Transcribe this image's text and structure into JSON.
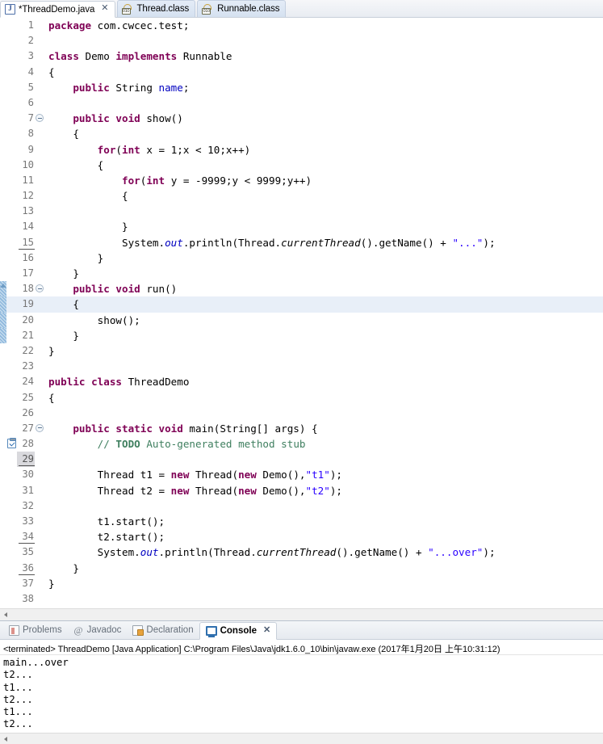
{
  "editor_tabs": [
    {
      "label": "*ThreadDemo.java",
      "icon": "java-file-icon",
      "active": true,
      "closeable": true
    },
    {
      "label": "Thread.class",
      "icon": "class-file-icon",
      "active": false,
      "closeable": false
    },
    {
      "label": "Runnable.class",
      "icon": "class-file-icon",
      "active": false,
      "closeable": false
    }
  ],
  "code": {
    "lines": [
      {
        "n": 1,
        "fold": false,
        "todo": false,
        "change": false,
        "cur": false,
        "numstyle": "plain",
        "tokens": [
          {
            "t": "package ",
            "c": "kw"
          },
          {
            "t": "com.cwcec.test;",
            "c": ""
          }
        ]
      },
      {
        "n": 2,
        "fold": false,
        "todo": false,
        "change": false,
        "cur": false,
        "numstyle": "plain",
        "tokens": []
      },
      {
        "n": 3,
        "fold": false,
        "todo": false,
        "change": false,
        "cur": false,
        "numstyle": "plain",
        "tokens": [
          {
            "t": "class ",
            "c": "kw"
          },
          {
            "t": "Demo ",
            "c": ""
          },
          {
            "t": "implements ",
            "c": "kw"
          },
          {
            "t": "Runnable",
            "c": ""
          }
        ]
      },
      {
        "n": 4,
        "fold": false,
        "todo": false,
        "change": false,
        "cur": false,
        "numstyle": "plain",
        "tokens": [
          {
            "t": "{",
            "c": ""
          }
        ]
      },
      {
        "n": 5,
        "fold": false,
        "todo": false,
        "change": false,
        "cur": false,
        "numstyle": "plain",
        "tokens": [
          {
            "t": "    ",
            "c": ""
          },
          {
            "t": "public ",
            "c": "kw"
          },
          {
            "t": "String ",
            "c": ""
          },
          {
            "t": "name",
            "c": "fld"
          },
          {
            "t": ";",
            "c": ""
          }
        ]
      },
      {
        "n": 6,
        "fold": false,
        "todo": false,
        "change": false,
        "cur": false,
        "numstyle": "plain",
        "tokens": []
      },
      {
        "n": 7,
        "fold": true,
        "todo": false,
        "change": false,
        "cur": false,
        "numstyle": "plain",
        "tokens": [
          {
            "t": "    ",
            "c": ""
          },
          {
            "t": "public void ",
            "c": "kw"
          },
          {
            "t": "show()",
            "c": ""
          }
        ]
      },
      {
        "n": 8,
        "fold": false,
        "todo": false,
        "change": false,
        "cur": false,
        "numstyle": "plain",
        "tokens": [
          {
            "t": "    {",
            "c": ""
          }
        ]
      },
      {
        "n": 9,
        "fold": false,
        "todo": false,
        "change": false,
        "cur": false,
        "numstyle": "plain",
        "tokens": [
          {
            "t": "        ",
            "c": ""
          },
          {
            "t": "for",
            "c": "kw"
          },
          {
            "t": "(",
            "c": ""
          },
          {
            "t": "int ",
            "c": "kw"
          },
          {
            "t": "x = 1;x < 10;x++)",
            "c": ""
          }
        ]
      },
      {
        "n": 10,
        "fold": false,
        "todo": false,
        "change": false,
        "cur": false,
        "numstyle": "plain",
        "tokens": [
          {
            "t": "        {",
            "c": ""
          }
        ]
      },
      {
        "n": 11,
        "fold": false,
        "todo": false,
        "change": false,
        "cur": false,
        "numstyle": "plain",
        "tokens": [
          {
            "t": "            ",
            "c": ""
          },
          {
            "t": "for",
            "c": "kw"
          },
          {
            "t": "(",
            "c": ""
          },
          {
            "t": "int ",
            "c": "kw"
          },
          {
            "t": "y = -9999;y < 9999;y++)",
            "c": ""
          }
        ]
      },
      {
        "n": 12,
        "fold": false,
        "todo": false,
        "change": false,
        "cur": false,
        "numstyle": "plain",
        "tokens": [
          {
            "t": "            {",
            "c": ""
          }
        ]
      },
      {
        "n": 13,
        "fold": false,
        "todo": false,
        "change": false,
        "cur": false,
        "numstyle": "plain",
        "tokens": []
      },
      {
        "n": 14,
        "fold": false,
        "todo": false,
        "change": false,
        "cur": false,
        "numstyle": "plain",
        "tokens": [
          {
            "t": "            }",
            "c": ""
          }
        ]
      },
      {
        "n": 15,
        "fold": false,
        "todo": false,
        "change": false,
        "cur": false,
        "numstyle": "underlined",
        "tokens": [
          {
            "t": "            System.",
            "c": ""
          },
          {
            "t": "out",
            "c": "statb"
          },
          {
            "t": ".println(Thread.",
            "c": ""
          },
          {
            "t": "currentThread",
            "c": "stat"
          },
          {
            "t": "().getName() + ",
            "c": ""
          },
          {
            "t": "\"...\"",
            "c": "str"
          },
          {
            "t": ");",
            "c": ""
          }
        ]
      },
      {
        "n": 16,
        "fold": false,
        "todo": false,
        "change": false,
        "cur": false,
        "numstyle": "plain",
        "tokens": [
          {
            "t": "        }",
            "c": ""
          }
        ]
      },
      {
        "n": 17,
        "fold": false,
        "todo": false,
        "change": false,
        "cur": false,
        "numstyle": "plain",
        "tokens": [
          {
            "t": "    }",
            "c": ""
          }
        ]
      },
      {
        "n": 18,
        "fold": true,
        "todo": false,
        "change": true,
        "cur": false,
        "numstyle": "plain",
        "tri": true,
        "tokens": [
          {
            "t": "    ",
            "c": ""
          },
          {
            "t": "public void ",
            "c": "kw"
          },
          {
            "t": "run()",
            "c": ""
          }
        ]
      },
      {
        "n": 19,
        "fold": false,
        "todo": false,
        "change": true,
        "cur": true,
        "numstyle": "plain",
        "tokens": [
          {
            "t": "    {",
            "c": ""
          }
        ]
      },
      {
        "n": 20,
        "fold": false,
        "todo": false,
        "change": true,
        "cur": false,
        "numstyle": "plain",
        "tokens": [
          {
            "t": "        show();",
            "c": ""
          }
        ]
      },
      {
        "n": 21,
        "fold": false,
        "todo": false,
        "change": true,
        "cur": false,
        "numstyle": "plain",
        "tokens": [
          {
            "t": "    }",
            "c": ""
          }
        ]
      },
      {
        "n": 22,
        "fold": false,
        "todo": false,
        "change": false,
        "cur": false,
        "numstyle": "plain",
        "tokens": [
          {
            "t": "}",
            "c": ""
          }
        ]
      },
      {
        "n": 23,
        "fold": false,
        "todo": false,
        "change": false,
        "cur": false,
        "numstyle": "plain",
        "tokens": []
      },
      {
        "n": 24,
        "fold": false,
        "todo": false,
        "change": false,
        "cur": false,
        "numstyle": "plain",
        "tokens": [
          {
            "t": "public class ",
            "c": "kw"
          },
          {
            "t": "ThreadDemo",
            "c": ""
          }
        ]
      },
      {
        "n": 25,
        "fold": false,
        "todo": false,
        "change": false,
        "cur": false,
        "numstyle": "plain",
        "tokens": [
          {
            "t": "{",
            "c": ""
          }
        ]
      },
      {
        "n": 26,
        "fold": false,
        "todo": false,
        "change": false,
        "cur": false,
        "numstyle": "plain",
        "tokens": []
      },
      {
        "n": 27,
        "fold": true,
        "todo": false,
        "change": false,
        "cur": false,
        "numstyle": "plain",
        "tokens": [
          {
            "t": "    ",
            "c": ""
          },
          {
            "t": "public static void ",
            "c": "kw"
          },
          {
            "t": "main(String[] args) {",
            "c": ""
          }
        ]
      },
      {
        "n": 28,
        "fold": false,
        "todo": true,
        "change": false,
        "cur": false,
        "numstyle": "plain",
        "tokens": [
          {
            "t": "        ",
            "c": ""
          },
          {
            "t": "// ",
            "c": "cmt"
          },
          {
            "t": "TODO",
            "c": "todo-w"
          },
          {
            "t": " Auto-generated method stub",
            "c": "cmt"
          }
        ]
      },
      {
        "n": 29,
        "fold": false,
        "todo": false,
        "change": false,
        "cur": false,
        "numstyle": "boxed",
        "tokens": []
      },
      {
        "n": 30,
        "fold": false,
        "todo": false,
        "change": false,
        "cur": false,
        "numstyle": "plain",
        "tokens": [
          {
            "t": "        Thread t1 = ",
            "c": ""
          },
          {
            "t": "new ",
            "c": "kw"
          },
          {
            "t": "Thread(",
            "c": ""
          },
          {
            "t": "new ",
            "c": "kw"
          },
          {
            "t": "Demo(),",
            "c": ""
          },
          {
            "t": "\"t1\"",
            "c": "str"
          },
          {
            "t": ");",
            "c": ""
          }
        ]
      },
      {
        "n": 31,
        "fold": false,
        "todo": false,
        "change": false,
        "cur": false,
        "numstyle": "plain",
        "tokens": [
          {
            "t": "        Thread t2 = ",
            "c": ""
          },
          {
            "t": "new ",
            "c": "kw"
          },
          {
            "t": "Thread(",
            "c": ""
          },
          {
            "t": "new ",
            "c": "kw"
          },
          {
            "t": "Demo(),",
            "c": ""
          },
          {
            "t": "\"t2\"",
            "c": "str"
          },
          {
            "t": ");",
            "c": ""
          }
        ]
      },
      {
        "n": 32,
        "fold": false,
        "todo": false,
        "change": false,
        "cur": false,
        "numstyle": "plain",
        "tokens": []
      },
      {
        "n": 33,
        "fold": false,
        "todo": false,
        "change": false,
        "cur": false,
        "numstyle": "plain",
        "tokens": [
          {
            "t": "        t1.start();",
            "c": ""
          }
        ]
      },
      {
        "n": 34,
        "fold": false,
        "todo": false,
        "change": false,
        "cur": false,
        "numstyle": "underlined",
        "tokens": [
          {
            "t": "        t2.start();",
            "c": ""
          }
        ]
      },
      {
        "n": 35,
        "fold": false,
        "todo": false,
        "change": false,
        "cur": false,
        "numstyle": "plain",
        "tokens": [
          {
            "t": "        System.",
            "c": ""
          },
          {
            "t": "out",
            "c": "statb"
          },
          {
            "t": ".println(Thread.",
            "c": ""
          },
          {
            "t": "currentThread",
            "c": "stat"
          },
          {
            "t": "().getName() + ",
            "c": ""
          },
          {
            "t": "\"...over\"",
            "c": "str"
          },
          {
            "t": ");",
            "c": ""
          }
        ]
      },
      {
        "n": 36,
        "fold": false,
        "todo": false,
        "change": false,
        "cur": false,
        "numstyle": "underlined",
        "tokens": [
          {
            "t": "    }",
            "c": ""
          }
        ]
      },
      {
        "n": 37,
        "fold": false,
        "todo": false,
        "change": false,
        "cur": false,
        "numstyle": "plain",
        "tokens": [
          {
            "t": "}",
            "c": ""
          }
        ]
      },
      {
        "n": 38,
        "fold": false,
        "todo": false,
        "change": false,
        "cur": false,
        "numstyle": "plain",
        "tokens": []
      }
    ]
  },
  "panel_tabs": [
    {
      "label": "Problems",
      "icon": "problems-icon",
      "active": false,
      "closeable": false
    },
    {
      "label": "Javadoc",
      "icon": "javadoc-icon",
      "active": false,
      "closeable": false
    },
    {
      "label": "Declaration",
      "icon": "declaration-icon",
      "active": false,
      "closeable": false
    },
    {
      "label": "Console",
      "icon": "console-icon",
      "active": true,
      "closeable": true
    }
  ],
  "console": {
    "status_line": "<terminated> ThreadDemo [Java Application] C:\\Program Files\\Java\\jdk1.6.0_10\\bin\\javaw.exe (2017年1月20日 上午10:31:12)",
    "output": [
      "main...over",
      "t2...",
      "t1...",
      "t2...",
      "t1...",
      "t2..."
    ]
  },
  "colors": {
    "keyword": "#7f0055",
    "string": "#2a00ff",
    "comment": "#3f7f5f",
    "field": "#0000c0",
    "current_line": "#e8eff8",
    "change_bar": "#8fb8dd",
    "tab_active_bg": "#ffffff"
  },
  "icons": {
    "close": "✕"
  }
}
